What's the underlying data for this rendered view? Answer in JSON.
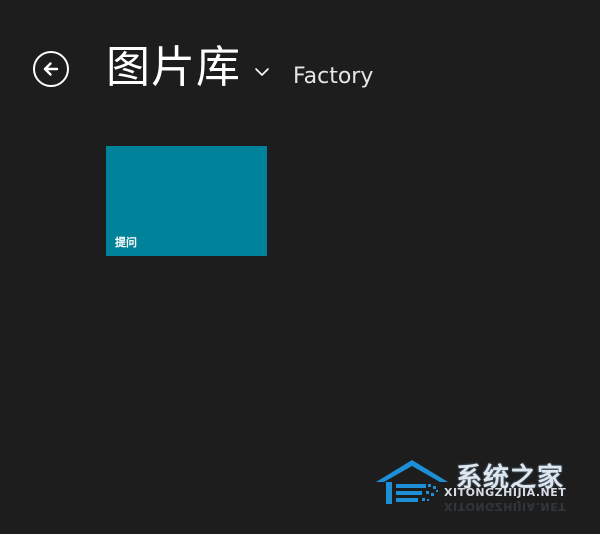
{
  "header": {
    "title": "图片库",
    "subtitle": "Factory",
    "back_icon": "back-arrow-icon",
    "dropdown_icon": "chevron-down-icon"
  },
  "tiles": [
    {
      "label": "提问",
      "color": "#00829b"
    }
  ],
  "watermark": {
    "name": "系统之家",
    "url": "XITONGZHIJIA.NET",
    "accent_color": "#1e8fd6"
  },
  "colors": {
    "background": "#1d1d1d",
    "text": "#ffffff"
  }
}
